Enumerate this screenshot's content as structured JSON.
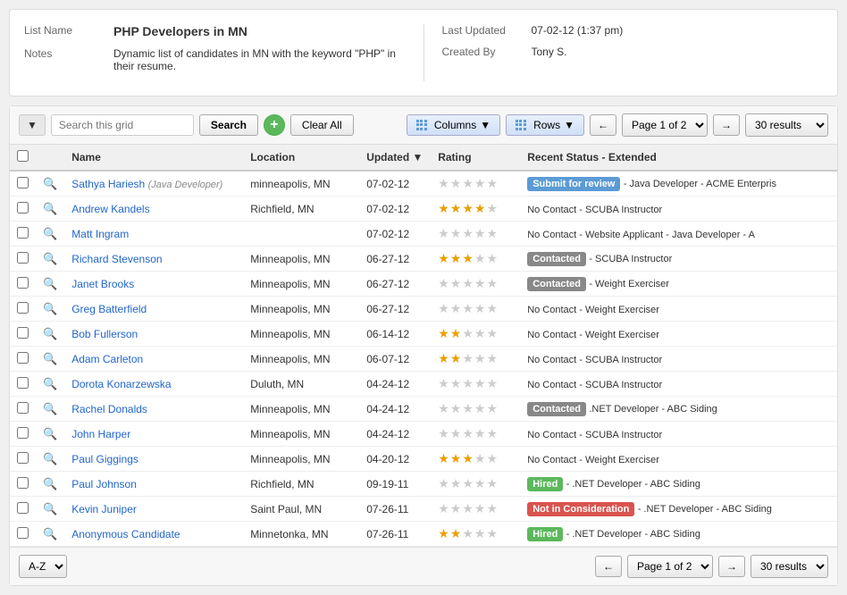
{
  "infoCard": {
    "listNameLabel": "List Name",
    "listNameValue": "PHP Developers in MN",
    "notesLabel": "Notes",
    "notesValue": "Dynamic list of candidates in MN with the keyword \"PHP\" in their resume.",
    "lastUpdatedLabel": "Last Updated",
    "lastUpdatedValue": "07-02-12 (1:37 pm)",
    "createdByLabel": "Created By",
    "createdByValue": "Tony S."
  },
  "toolbar": {
    "searchPlaceholder": "Search this grid",
    "searchLabel": "Search",
    "clearLabel": "Clear All",
    "columnsLabel": "Columns",
    "rowsLabel": "Rows",
    "pageLabel": "Page 1 of 2",
    "resultsLabel": "30 results",
    "addIcon": "+"
  },
  "table": {
    "headers": [
      "",
      "",
      "Name",
      "Location",
      "Updated",
      "Rating",
      "Recent Status - Extended"
    ],
    "rows": [
      {
        "name": "Sathya Hariesh",
        "nameTag": "Java Developer",
        "location": "minneapolis, MN",
        "updated": "07-02-12",
        "stars": 0,
        "badge": "submit",
        "badgeText": "Submit for review",
        "statusText": "- Java Developer - ACME Enterpris"
      },
      {
        "name": "Andrew Kandels",
        "nameTag": "",
        "location": "Richfield, MN",
        "updated": "07-02-12",
        "stars": 4,
        "badge": "",
        "badgeText": "",
        "statusText": "No Contact - SCUBA Instructor"
      },
      {
        "name": "Matt Ingram",
        "nameTag": "",
        "location": "",
        "updated": "07-02-12",
        "stars": 0,
        "badge": "",
        "badgeText": "",
        "statusText": "No Contact - Website Applicant  - Java Developer - A"
      },
      {
        "name": "Richard Stevenson",
        "nameTag": "",
        "location": "Minneapolis, MN",
        "updated": "06-27-12",
        "stars": 3,
        "badge": "contacted",
        "badgeText": "Contacted",
        "statusText": "- SCUBA Instructor"
      },
      {
        "name": "Janet Brooks",
        "nameTag": "",
        "location": "Minneapolis, MN",
        "updated": "06-27-12",
        "stars": 0,
        "badge": "contacted",
        "badgeText": "Contacted",
        "statusText": "- Weight Exerciser"
      },
      {
        "name": "Greg Batterfield",
        "nameTag": "",
        "location": "Minneapolis, MN",
        "updated": "06-27-12",
        "stars": 0,
        "badge": "",
        "badgeText": "",
        "statusText": "No Contact - Weight Exerciser"
      },
      {
        "name": "Bob Fullerson",
        "nameTag": "",
        "location": "Minneapolis, MN",
        "updated": "06-14-12",
        "stars": 2,
        "badge": "",
        "badgeText": "",
        "statusText": "No Contact - Weight Exerciser"
      },
      {
        "name": "Adam Carleton",
        "nameTag": "",
        "location": "Minneapolis, MN",
        "updated": "06-07-12",
        "stars": 2,
        "badge": "",
        "badgeText": "",
        "statusText": "No Contact - SCUBA Instructor"
      },
      {
        "name": "Dorota Konarzewska",
        "nameTag": "",
        "location": "Duluth, MN",
        "updated": "04-24-12",
        "stars": 0,
        "badge": "",
        "badgeText": "",
        "statusText": "No Contact - SCUBA Instructor"
      },
      {
        "name": "Rachel Donalds",
        "nameTag": "",
        "location": "Minneapolis, MN",
        "updated": "04-24-12",
        "stars": 0,
        "badge": "contacted",
        "badgeText": "Contacted",
        "statusText": ".NET Developer - ABC Siding"
      },
      {
        "name": "John Harper",
        "nameTag": "",
        "location": "Minneapolis, MN",
        "updated": "04-24-12",
        "stars": 0,
        "badge": "",
        "badgeText": "",
        "statusText": "No Contact - SCUBA Instructor"
      },
      {
        "name": "Paul Giggings",
        "nameTag": "",
        "location": "Minneapolis, MN",
        "updated": "04-20-12",
        "stars": 3,
        "badge": "",
        "badgeText": "",
        "statusText": "No Contact - Weight Exerciser"
      },
      {
        "name": "Paul Johnson",
        "nameTag": "",
        "location": "Richfield, MN",
        "updated": "09-19-11",
        "stars": 0,
        "badge": "hired",
        "badgeText": "Hired",
        "statusText": "- .NET Developer - ABC Siding"
      },
      {
        "name": "Kevin Juniper",
        "nameTag": "",
        "location": "Saint Paul, MN",
        "updated": "07-26-11",
        "stars": 0,
        "badge": "not-considered",
        "badgeText": "Not in Consideration",
        "statusText": "- .NET Developer - ABC Siding"
      },
      {
        "name": "Anonymous Candidate",
        "nameTag": "",
        "location": "Minnetonka, MN",
        "updated": "07-26-11",
        "stars": 2,
        "badge": "hired",
        "badgeText": "Hired",
        "statusText": "- .NET Developer - ABC Siding"
      }
    ]
  },
  "bottomToolbar": {
    "sortLabel": "A-Z",
    "pageLabel": "Page 1 of 2",
    "resultsLabel": "30 results"
  }
}
